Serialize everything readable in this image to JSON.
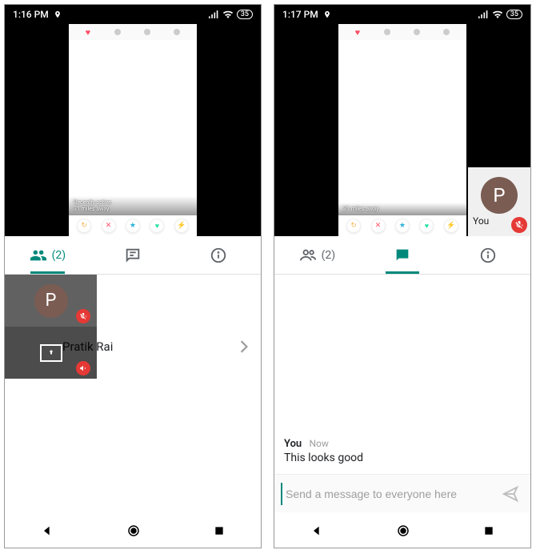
{
  "left": {
    "status": {
      "time": "1:16 PM",
      "battery": "35"
    },
    "shared": {
      "distance": "31 miles away",
      "status": "Recently active"
    },
    "tabs": {
      "people": {
        "count_label": "(2)",
        "active": true
      },
      "chat": {
        "active": false
      },
      "info": {}
    },
    "participants": {
      "overlay_initial": "P",
      "rows": [
        {
          "name": "Pratik Rai"
        }
      ]
    }
  },
  "right": {
    "status": {
      "time": "1:17 PM",
      "battery": "35"
    },
    "shared": {
      "distance": "31 miles away"
    },
    "you_tile": {
      "initial": "P",
      "label": "You",
      "muted": true
    },
    "tabs": {
      "people": {
        "count_label": "(2)",
        "active": false
      },
      "chat": {
        "active": true
      },
      "info": {}
    },
    "chat": {
      "messages": [
        {
          "sender": "You",
          "time": "Now",
          "body": "This looks good"
        }
      ],
      "placeholder": "Send a message to everyone here"
    }
  }
}
